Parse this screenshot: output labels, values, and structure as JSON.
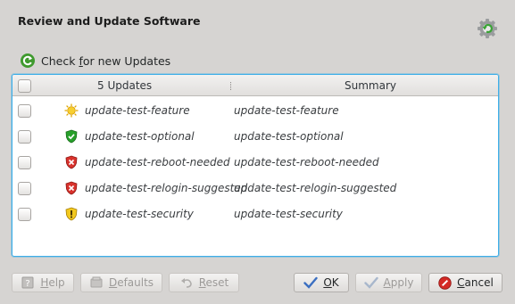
{
  "dialog": {
    "title": "Review and Update Software"
  },
  "toolbar": {
    "check_label_pre": "Check ",
    "check_label_accel": "f",
    "check_label_post": "or new Updates"
  },
  "table": {
    "header_count": "5 Updates",
    "header_summary": "Summary",
    "rows": [
      {
        "name": "update-test-feature",
        "summary": "update-test-feature",
        "icon": "sun-icon",
        "checked": false
      },
      {
        "name": "update-test-optional",
        "summary": "update-test-optional",
        "icon": "green-shield-icon",
        "checked": false
      },
      {
        "name": "update-test-reboot-needed",
        "summary": "update-test-reboot-needed",
        "icon": "red-shield-icon",
        "checked": false
      },
      {
        "name": "update-test-relogin-suggested",
        "summary": "update-test-relogin-suggested",
        "icon": "red-shield-icon",
        "checked": false
      },
      {
        "name": "update-test-security",
        "summary": "update-test-security",
        "icon": "yellow-shield-icon",
        "checked": false
      }
    ]
  },
  "buttons": {
    "help": {
      "accel": "H",
      "rest": "elp",
      "enabled": false
    },
    "defaults": {
      "accel": "D",
      "rest": "efaults",
      "enabled": false
    },
    "reset": {
      "accel": "R",
      "rest": "eset",
      "enabled": false
    },
    "ok": {
      "accel": "O",
      "rest": "K",
      "enabled": true
    },
    "apply": {
      "accel": "A",
      "rest": "pply",
      "enabled": false
    },
    "cancel": {
      "accel": "C",
      "rest": "ancel",
      "enabled": true
    }
  },
  "colors": {
    "focus_border": "#3daee9",
    "background": "#d6d4d2"
  }
}
